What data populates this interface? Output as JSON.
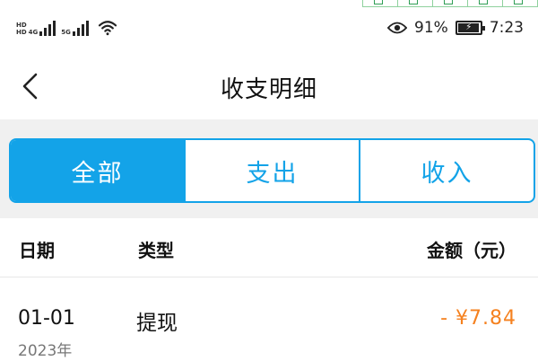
{
  "status_bar": {
    "sim1_labels": [
      "HD",
      "HD"
    ],
    "sim1_network": "4G",
    "sim2_network": "5G",
    "battery_percent": "91%",
    "time": "7:23",
    "battery_level": 0.91,
    "icons": [
      "signal-icon",
      "wifi-icon",
      "eye-icon",
      "battery-icon"
    ]
  },
  "header": {
    "title": "收支明细",
    "back_icon": "chevron-left-icon"
  },
  "tabs": [
    {
      "label": "全部",
      "active": true
    },
    {
      "label": "支出",
      "active": false
    },
    {
      "label": "收入",
      "active": false
    }
  ],
  "table": {
    "headers": {
      "date": "日期",
      "type": "类型",
      "amount": "金额（元）"
    },
    "rows": [
      {
        "date": "01-01",
        "year": "2023年",
        "type": "提现",
        "amount": "- ¥7.84"
      }
    ]
  },
  "colors": {
    "accent": "#13a3e8",
    "expense": "#f5811f",
    "band": "#f0f0f0"
  }
}
